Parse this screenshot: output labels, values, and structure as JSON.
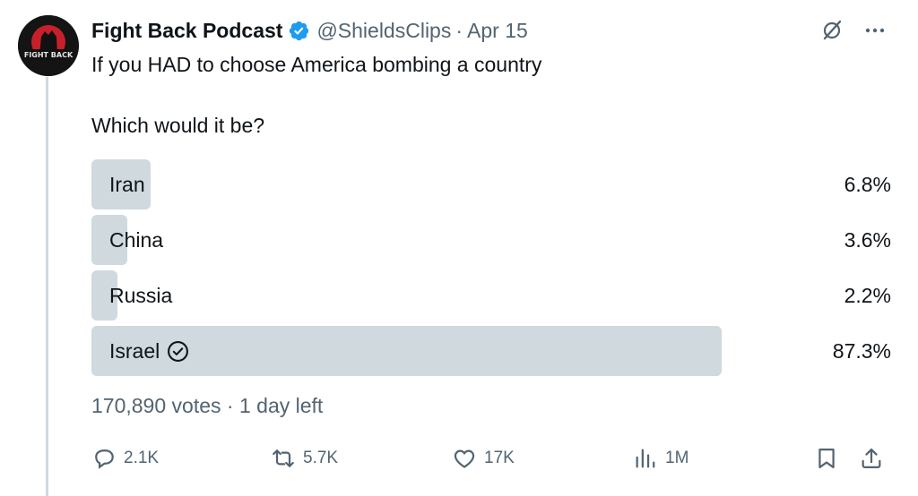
{
  "tweet": {
    "display_name": "Fight Back Podcast",
    "handle": "@ShieldsClips",
    "separator": "·",
    "date": "Apr 15",
    "text_line1": "If you HAD to choose America bombing a country",
    "text_line2": "Which would it be?"
  },
  "avatar": {
    "text": "FIGHT BACK"
  },
  "poll": {
    "options": [
      {
        "label": "Iran",
        "percent_text": "6.8%",
        "percent": 6.8
      },
      {
        "label": "China",
        "percent_text": "3.6%",
        "percent": 3.6
      },
      {
        "label": "Russia",
        "percent_text": "2.2%",
        "percent": 2.2
      },
      {
        "label": "Israel",
        "percent_text": "87.3%",
        "percent": 87.3,
        "winner": true
      }
    ],
    "votes": "170,890 votes",
    "separator": "·",
    "time_left": "1 day left"
  },
  "actions": {
    "replies": "2.1K",
    "reposts": "5.7K",
    "likes": "17K",
    "views": "1M"
  },
  "colors": {
    "bar": "#cfd9de",
    "verified": "#1d9bf0",
    "muted": "#536471",
    "text": "#0f1419"
  }
}
